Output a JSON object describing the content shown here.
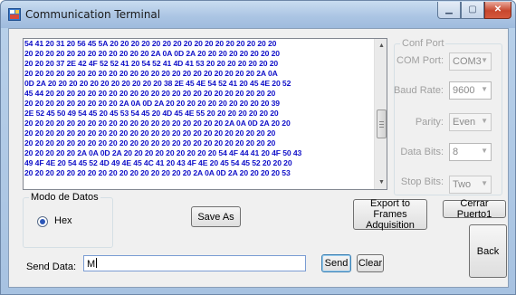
{
  "window": {
    "title": "Communication Terminal",
    "min_glyph": "▁",
    "max_glyph": "▢",
    "close_glyph": "✕"
  },
  "terminal": {
    "lines": [
      "54 41 20 31 20 56 45 5A 20 20 20 20 20 20 20 20 20 20 20 20 20 20 20 20",
      "20 20 20 20 20 20 20 20 20 20 20 20 2A 0A 0D 2A 20 20 20 20 20 20 20 20",
      "20 20 20 37 2E 42 4F 52 52 41 20 54 52 41 4D 41 53 20 20 20 20 20 20 20",
      "20 20 20 20 20 20 20 20 20 20 20 20 20 20 20 20 20 20 20 20 20 20 2A 0A",
      "0D 2A 20 20 20 20 20 20 20 20 20 20 20 38 2E 45 4E 54 52 41 20 45 4E 20 52",
      "45 44 20 20 20 20 20 20 20 20 20 20 20 20 20 20 20 20 20 20 20 20 20 20",
      "20 20 20 20 20 20 20 20 20 2A 0A 0D 2A 20 20 20 20 20 20 20 20 20 20 39",
      "2E 52 45 50 49 54 45 20 45 53 54 45 20 4D 45 4E 55 20 20 20 20 20 20 20",
      "20 20 20 20 20 20 20 20 20 20 20 20 20 20 20 20 20 20 20 2A 0A 0D 2A 20 20",
      "20 20 20 20 20 20 20 20 20 20 20 20 20 20 20 20 20 20 20 20 20 20 20 20",
      "20 20 20 20 20 20 20 20 20 20 20 20 20 20 20 20 20 20 20 20 20 20 20 20",
      "20 20 20 20 20 2A 0A 0D 2A 20 20 20 20 20 20 20 20 20 54 4F 44 41 20 4F 50 43",
      "49 4F 4E 20 54 45 52 4D 49 4E 45 4C 41 20 43 4F 4E 20 45 54 45 52 20 20 20",
      "20 20 20 20 20 20 20 20 20 20 20 20 20 20 20 20 2A 0A 0D 2A 20 20 20 20 53"
    ],
    "scroll_position": 0.62
  },
  "conf_port": {
    "title": "Conf Port",
    "com_label": "COM Port:",
    "com_value": "COM3",
    "baud_label": "Baud Rate:",
    "baud_value": "9600",
    "parity_label": "Parity:",
    "parity_value": "Even",
    "data_label": "Data Bits:",
    "data_value": "8",
    "stop_label": "Stop Bits:",
    "stop_value": "Two"
  },
  "modo": {
    "title": "Modo de Datos",
    "hex_label": "Hex"
  },
  "buttons": {
    "save_as": "Save As",
    "export": "Export to Frames Adquisition",
    "cerrar": "Cerrar Puerto1",
    "back": "Back",
    "send": "Send",
    "clear": "Clear"
  },
  "send": {
    "label": "Send Data:",
    "value": "M"
  }
}
